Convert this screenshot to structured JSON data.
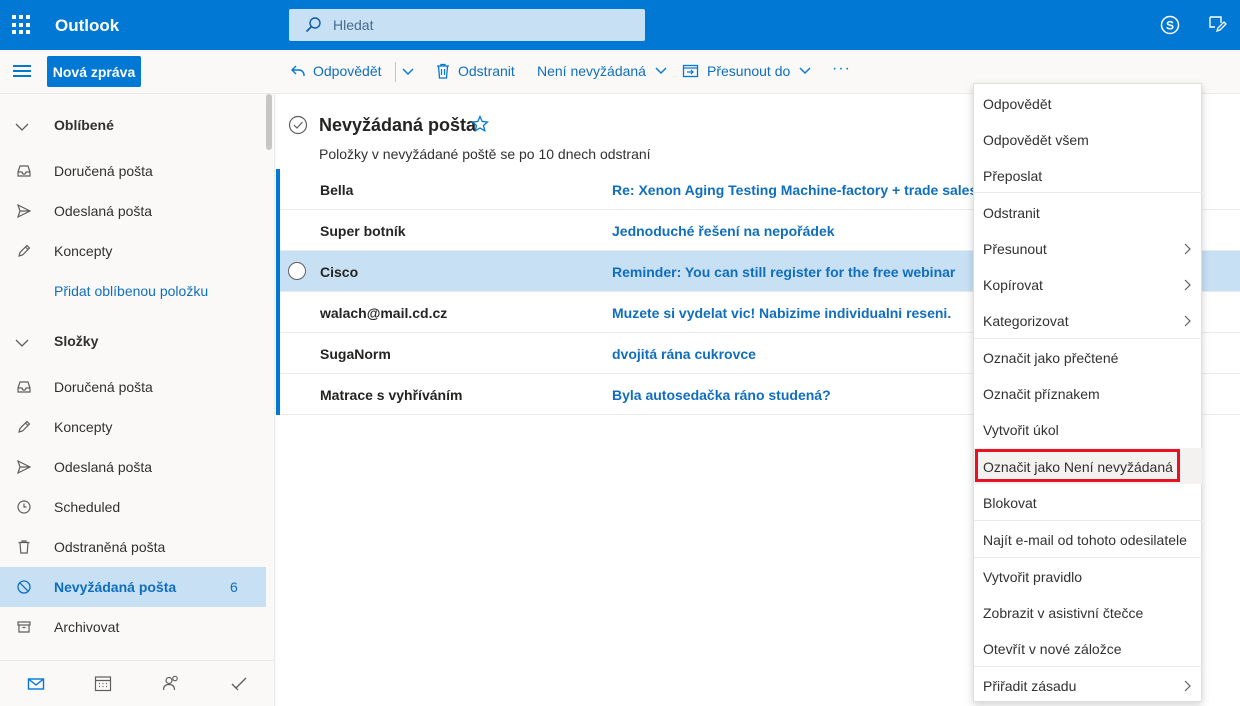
{
  "app": {
    "title": "Outlook",
    "accent": "#0078d4"
  },
  "search": {
    "placeholder": "Hledat"
  },
  "toolbar": {
    "new_message": "Nová zpráva",
    "reply": "Odpovědět",
    "delete": "Odstranit",
    "not_junk": "Není nevyžádaná",
    "move_to": "Přesunout do",
    "more": "···"
  },
  "sidebar": {
    "favorites_label": "Oblíbené",
    "favorites": [
      {
        "label": "Doručená pošta",
        "icon": "inbox-icon"
      },
      {
        "label": "Odeslaná pošta",
        "icon": "send-icon"
      },
      {
        "label": "Koncepty",
        "icon": "pencil-icon"
      }
    ],
    "add_favorite": "Přidat oblíbenou položku",
    "folders_label": "Složky",
    "folders": [
      {
        "label": "Doručená pošta",
        "icon": "inbox-icon"
      },
      {
        "label": "Koncepty",
        "icon": "pencil-icon"
      },
      {
        "label": "Odeslaná pošta",
        "icon": "send-icon"
      },
      {
        "label": "Scheduled",
        "icon": "clock-icon"
      },
      {
        "label": "Odstraněná pošta",
        "icon": "trash-icon"
      },
      {
        "label": "Nevyžádaná pošta",
        "icon": "block-icon",
        "count": "6",
        "active": true
      },
      {
        "label": "Archivovat",
        "icon": "archive-icon"
      }
    ]
  },
  "folder": {
    "title": "Nevyžádaná pošta",
    "notice": "Položky v nevyžádané poště se po 10 dnech odstraní"
  },
  "messages": [
    {
      "sender": "Bella",
      "subject": "Re: Xenon Aging Testing Machine-factory + trade sales b"
    },
    {
      "sender": "Super botník",
      "subject": "Jednoduché řešení na nepořádek"
    },
    {
      "sender": "Cisco",
      "subject": "Reminder: You can still register for the free webinar",
      "selected": true
    },
    {
      "sender": "walach@mail.cd.cz",
      "subject": "Muzete si vydelat vic! Nabizime individualni reseni."
    },
    {
      "sender": "SugaNorm",
      "subject": "dvojitá rána cukrovce"
    },
    {
      "sender": "Matrace s vyhříváním",
      "subject": "Byla autosedačka ráno studená?"
    }
  ],
  "context_menu": [
    {
      "label": "Odpovědět"
    },
    {
      "label": "Odpovědět všem"
    },
    {
      "label": "Přeposlat"
    },
    {
      "label": "Odstranit"
    },
    {
      "label": "Přesunout",
      "submenu": true
    },
    {
      "label": "Kopírovat",
      "submenu": true
    },
    {
      "label": "Kategorizovat",
      "submenu": true
    },
    {
      "label": "Označit jako přečtené"
    },
    {
      "label": "Označit příznakem"
    },
    {
      "label": "Vytvořit úkol"
    },
    {
      "label": "Označit jako Není nevyžádaná",
      "highlighted": true
    },
    {
      "label": "Blokovat"
    },
    {
      "label": "Najít e-mail od tohoto odesilatele"
    },
    {
      "label": "Vytvořit pravidlo"
    },
    {
      "label": "Zobrazit v asistivní čtečce"
    },
    {
      "label": "Otevřít v nové záložce"
    },
    {
      "label": "Přiřadit zásadu",
      "submenu": true
    }
  ]
}
